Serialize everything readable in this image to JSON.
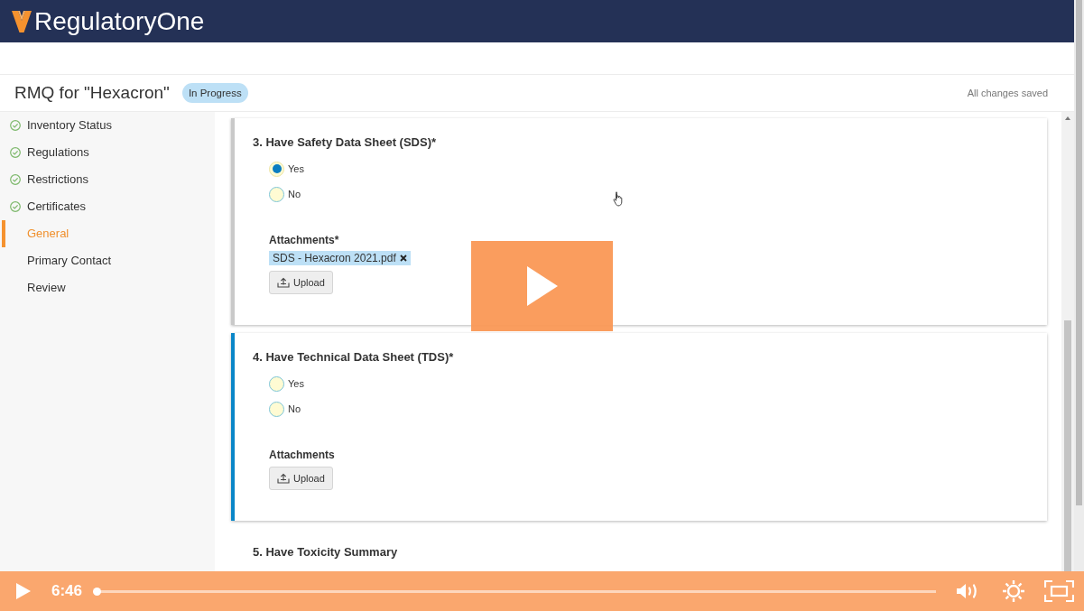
{
  "header": {
    "brand": "RegulatoryOne"
  },
  "page": {
    "title": "RMQ for \"Hexacron\"",
    "status": "In Progress",
    "save_status": "All changes saved"
  },
  "sidebar": {
    "items": [
      {
        "label": "Inventory Status",
        "completed": true,
        "selected": false
      },
      {
        "label": "Regulations",
        "completed": true,
        "selected": false
      },
      {
        "label": "Restrictions",
        "completed": true,
        "selected": false
      },
      {
        "label": "Certificates",
        "completed": true,
        "selected": false
      },
      {
        "label": "General",
        "completed": false,
        "selected": true
      },
      {
        "label": "Primary Contact",
        "completed": false,
        "selected": false
      },
      {
        "label": "Review",
        "completed": false,
        "selected": false
      }
    ]
  },
  "questions": [
    {
      "kind": "card",
      "active": false,
      "title": "3. Have Safety Data Sheet (SDS)*",
      "options": [
        {
          "label": "Yes",
          "selected": true
        },
        {
          "label": "No",
          "selected": false
        }
      ],
      "attachments": {
        "label": "Attachments*",
        "files": [
          "SDS - Hexacron 2021.pdf"
        ],
        "upload_button": "Upload"
      }
    },
    {
      "kind": "card",
      "active": true,
      "title": "4. Have Technical Data Sheet (TDS)*",
      "options": [
        {
          "label": "Yes",
          "selected": false
        },
        {
          "label": "No",
          "selected": false
        }
      ],
      "attachments": {
        "label": "Attachments",
        "upload_button": "Upload"
      }
    },
    {
      "kind": "plain",
      "title": "5. Have Toxicity Summary"
    }
  ],
  "player": {
    "playing": false,
    "time": "6:46",
    "level": 0
  }
}
